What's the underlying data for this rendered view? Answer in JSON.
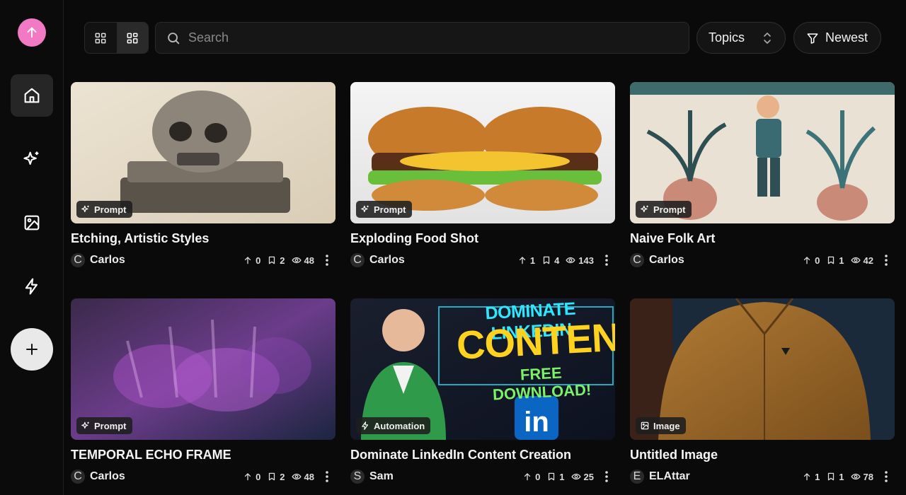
{
  "sidebar": {
    "logo_icon": "upload-arrow-icon",
    "accent": "#f27ac4",
    "nav": [
      {
        "name": "home",
        "icon": "home-icon",
        "active": true
      },
      {
        "name": "prompts",
        "icon": "sparkles-icon",
        "active": false
      },
      {
        "name": "images",
        "icon": "image-icon",
        "active": false
      },
      {
        "name": "automations",
        "icon": "lightning-icon",
        "active": false
      }
    ],
    "add_icon": "plus-icon"
  },
  "toolbar": {
    "view_options": [
      "grid-large",
      "grid-compact"
    ],
    "active_view": "grid-compact",
    "search_placeholder": "Search",
    "topics_label": "Topics",
    "sort_label": "Newest"
  },
  "cards": [
    {
      "title": "Etching, Artistic Styles",
      "badge": "Prompt",
      "badge_icon": "sparkles-icon",
      "author_initial": "C",
      "author": "Carlos",
      "upvotes": "0",
      "saves": "2",
      "views": "48"
    },
    {
      "title": "Exploding Food Shot",
      "badge": "Prompt",
      "badge_icon": "sparkles-icon",
      "author_initial": "C",
      "author": "Carlos",
      "upvotes": "1",
      "saves": "4",
      "views": "143"
    },
    {
      "title": "Naive Folk Art",
      "badge": "Prompt",
      "badge_icon": "sparkles-icon",
      "author_initial": "C",
      "author": "Carlos",
      "upvotes": "0",
      "saves": "1",
      "views": "42"
    },
    {
      "title": "TEMPORAL ECHO FRAME",
      "badge": "Prompt",
      "badge_icon": "sparkles-icon",
      "author_initial": "C",
      "author": "Carlos",
      "upvotes": "0",
      "saves": "2",
      "views": "48"
    },
    {
      "title": "Dominate LinkedIn Content Creation",
      "badge": "Automation",
      "badge_icon": "lightning-icon",
      "author_initial": "S",
      "author": "Sam",
      "upvotes": "0",
      "saves": "1",
      "views": "25",
      "thumb_text": {
        "line1": "DOMINATE LINKEDIN",
        "line2": "CONTENT",
        "line3": "FREE DOWNLOAD!",
        "logo": "in"
      }
    },
    {
      "title": "Untitled Image",
      "badge": "Image",
      "badge_icon": "image-icon",
      "author_initial": "E",
      "author": "ELAttar",
      "upvotes": "1",
      "saves": "1",
      "views": "78"
    }
  ]
}
